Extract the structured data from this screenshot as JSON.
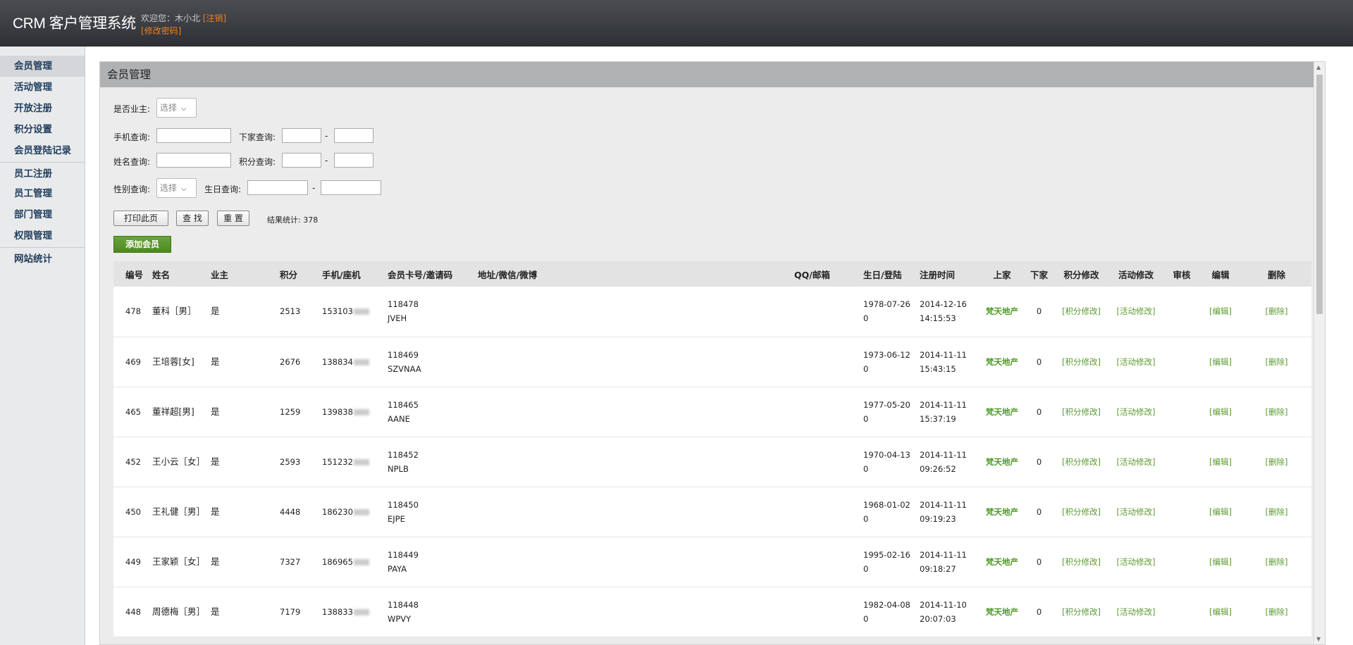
{
  "header": {
    "logo": "CRM 客户管理系统",
    "welcome_text": "欢迎您：木小北",
    "logout_link": "[注销]",
    "change_password_link": "[修改密码]"
  },
  "sidebar": {
    "items": [
      {
        "label": "会员管理"
      },
      {
        "label": "活动管理"
      },
      {
        "label": "开放注册"
      },
      {
        "label": "积分设置"
      },
      {
        "label": "会员登陆记录"
      },
      {
        "label": "员工注册"
      },
      {
        "label": "员工管理"
      },
      {
        "label": "部门管理"
      },
      {
        "label": "权限管理"
      },
      {
        "label": "网站统计"
      }
    ]
  },
  "panel": {
    "title": "会员管理"
  },
  "filters": {
    "owner_label": "是否业主:",
    "owner_select": "选择",
    "phone_label": "手机查询:",
    "downline_label": "下家查询:",
    "name_label": "姓名查询:",
    "points_label": "积分查询:",
    "gender_label": "性别查询:",
    "gender_select": "选择",
    "birthday_label": "生日查询:",
    "dash": "-"
  },
  "actions": {
    "print": "打印此页",
    "search": "查 找",
    "reset": "重 置",
    "result_label": "结果统计:",
    "result_count": "378",
    "add_member": "添加会员"
  },
  "table": {
    "headers": [
      "编号",
      "姓名",
      "业主",
      "积分",
      "手机/座机",
      "会员卡号/邀请码",
      "地址/微信/微博",
      "QQ/邮箱",
      "生日/登陆",
      "注册时间",
      "上家",
      "下家",
      "积分修改",
      "活动修改",
      "审核",
      "编辑",
      "删除"
    ],
    "rows": [
      {
        "id": "478",
        "name": "董科［男］",
        "owner": "是",
        "points": "2513",
        "phone": "153103",
        "card": "118478",
        "invite": "JVEH",
        "birthday": "1978-07-26",
        "login": "0",
        "reg_date": "2014-12-16",
        "reg_time": "14:15:53",
        "upline": "梵天地产",
        "downline": "0",
        "points_edit": "[积分修改]",
        "activity_edit": "[活动修改]",
        "edit": "[编辑]",
        "delete": "[删除]"
      },
      {
        "id": "469",
        "name": "王培蓉[女]",
        "owner": "是",
        "points": "2676",
        "phone": "138834",
        "card": "118469",
        "invite": "SZVNAA",
        "birthday": "1973-06-12",
        "login": "0",
        "reg_date": "2014-11-11",
        "reg_time": "15:43:15",
        "upline": "梵天地产",
        "downline": "0",
        "points_edit": "[积分修改]",
        "activity_edit": "[活动修改]",
        "edit": "[编辑]",
        "delete": "[删除]"
      },
      {
        "id": "465",
        "name": "董祥超[男]",
        "owner": "是",
        "points": "1259",
        "phone": "139838",
        "card": "118465",
        "invite": "AANE",
        "birthday": "1977-05-20",
        "login": "0",
        "reg_date": "2014-11-11",
        "reg_time": "15:37:19",
        "upline": "梵天地产",
        "downline": "0",
        "points_edit": "[积分修改]",
        "activity_edit": "[活动修改]",
        "edit": "[编辑]",
        "delete": "[删除]"
      },
      {
        "id": "452",
        "name": "王小云［女］",
        "owner": "是",
        "points": "2593",
        "phone": "151232",
        "card": "118452",
        "invite": "NPLB",
        "birthday": "1970-04-13",
        "login": "0",
        "reg_date": "2014-11-11",
        "reg_time": "09:26:52",
        "upline": "梵天地产",
        "downline": "0",
        "points_edit": "[积分修改]",
        "activity_edit": "[活动修改]",
        "edit": "[编辑]",
        "delete": "[删除]"
      },
      {
        "id": "450",
        "name": "王礼健［男］",
        "owner": "是",
        "points": "4448",
        "phone": "186230",
        "card": "118450",
        "invite": "EJPE",
        "birthday": "1968-01-02",
        "login": "0",
        "reg_date": "2014-11-11",
        "reg_time": "09:19:23",
        "upline": "梵天地产",
        "downline": "0",
        "points_edit": "[积分修改]",
        "activity_edit": "[活动修改]",
        "edit": "[编辑]",
        "delete": "[删除]"
      },
      {
        "id": "449",
        "name": "王家颖［女］",
        "owner": "是",
        "points": "7327",
        "phone": "186965",
        "card": "118449",
        "invite": "PAYA",
        "birthday": "1995-02-16",
        "login": "0",
        "reg_date": "2014-11-11",
        "reg_time": "09:18:27",
        "upline": "梵天地产",
        "downline": "0",
        "points_edit": "[积分修改]",
        "activity_edit": "[活动修改]",
        "edit": "[编辑]",
        "delete": "[删除]"
      },
      {
        "id": "448",
        "name": "周德梅［男］",
        "owner": "是",
        "points": "7179",
        "phone": "138833",
        "card": "118448",
        "invite": "WPVY",
        "birthday": "1982-04-08",
        "login": "0",
        "reg_date": "2014-11-10",
        "reg_time": "20:07:03",
        "upline": "梵天地产",
        "downline": "0",
        "points_edit": "[积分修改]",
        "activity_edit": "[活动修改]",
        "edit": "[编辑]",
        "delete": "[删除]"
      }
    ]
  }
}
